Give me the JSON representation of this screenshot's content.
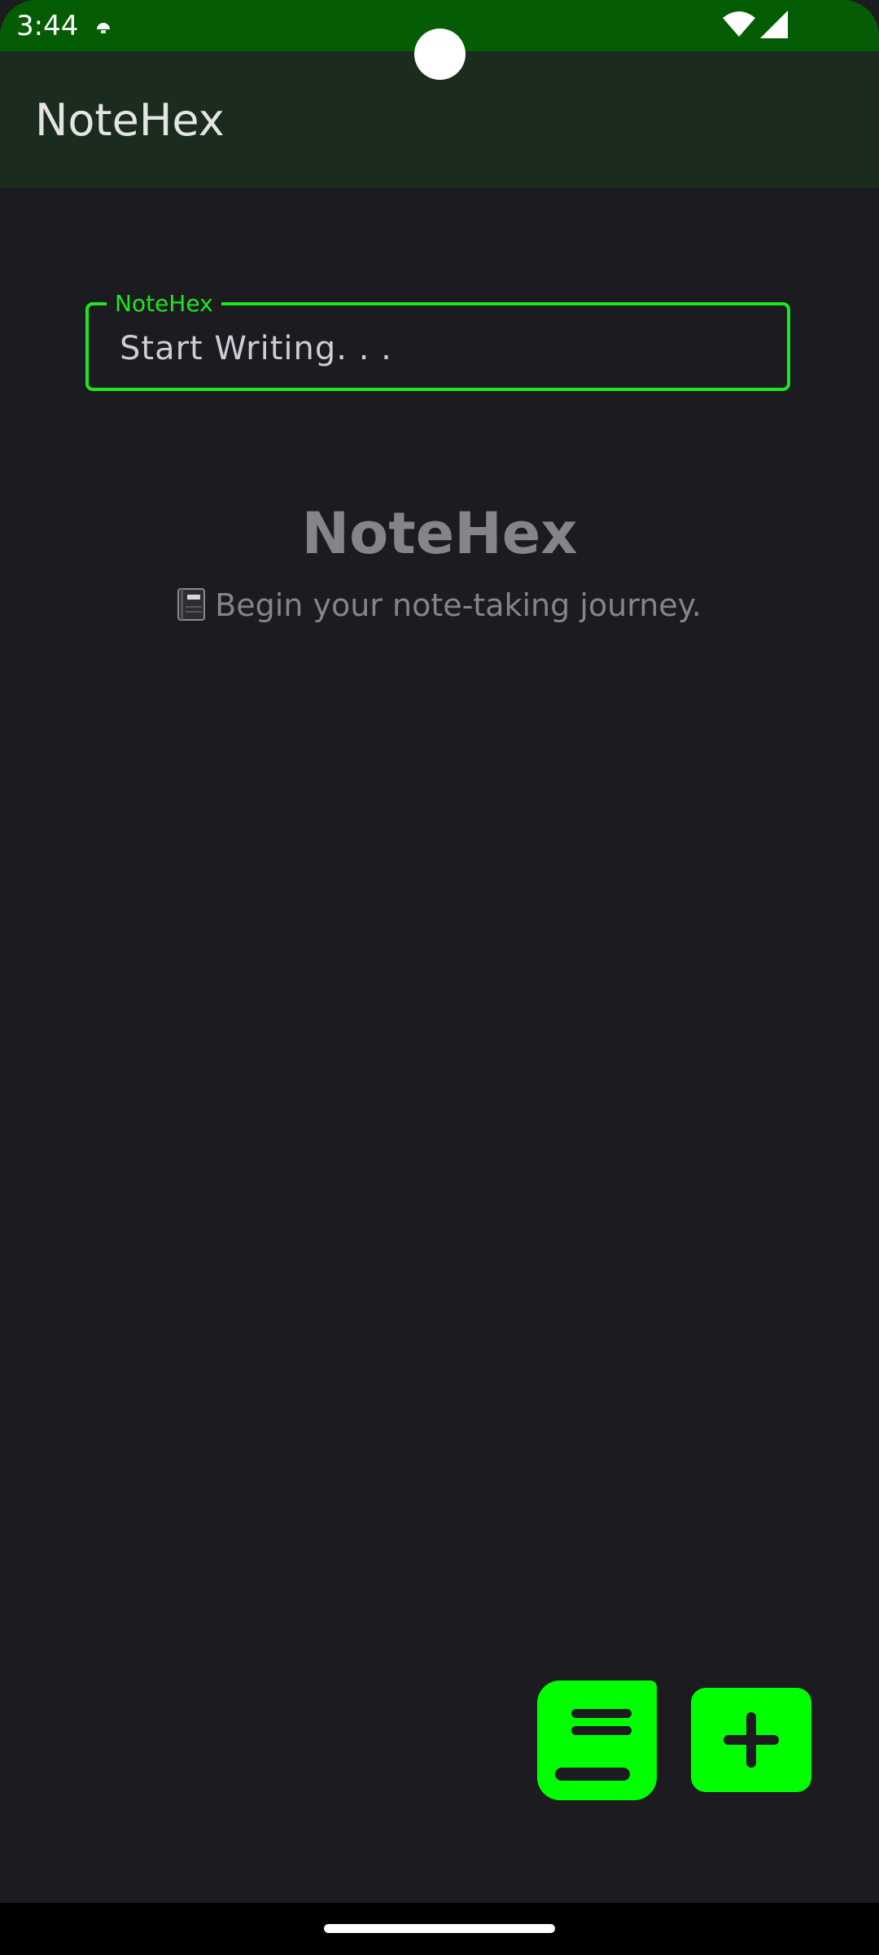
{
  "status_bar": {
    "time": "3:44",
    "notification_icon": "notification-dot-icon",
    "wifi_icon": "wifi-icon",
    "signal_icon": "cell-signal-icon"
  },
  "app_bar": {
    "title": "NoteHex"
  },
  "note_field": {
    "label": "NoteHex",
    "value": "Start Writing. . ."
  },
  "empty_state": {
    "title": "NoteHex",
    "subtitle": "Begin your note-taking journey.",
    "icon": "notebook-icon"
  },
  "fabs": {
    "notes_icon": "notes-book-icon",
    "add_icon": "plus-icon"
  },
  "colors": {
    "status_bar": "#045c04",
    "app_bar": "#1b2b1e",
    "background": "#1c1b20",
    "accent": "#1ee61e",
    "fab": "#00ff00"
  }
}
